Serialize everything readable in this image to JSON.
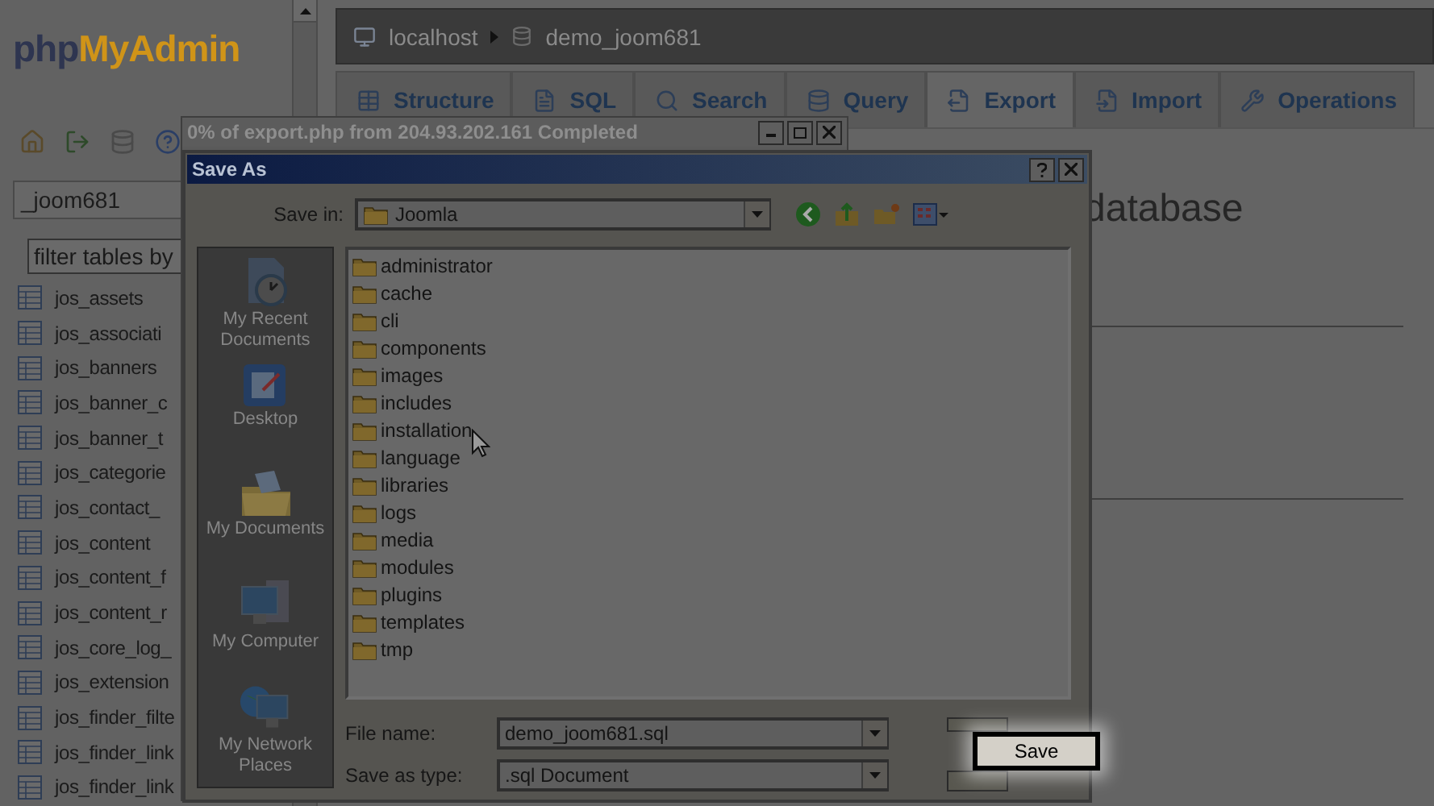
{
  "sidebar": {
    "logo": [
      "php",
      "MyAdmin"
    ],
    "database_select": "_joom681",
    "filter": {
      "placeholder": "filter tables by"
    },
    "tables": [
      "jos_assets",
      "jos_associati",
      "jos_banners",
      "jos_banner_c",
      "jos_banner_t",
      "jos_categorie",
      "jos_contact_",
      "jos_content",
      "jos_content_f",
      "jos_content_r",
      "jos_core_log_",
      "jos_extension",
      "jos_finder_filte",
      "jos_finder_link",
      "jos_finder_link"
    ]
  },
  "breadcrumb": [
    "localhost",
    "demo_joom681"
  ],
  "tabs": [
    {
      "label": "Structure",
      "selected": false
    },
    {
      "label": "SQL",
      "selected": false
    },
    {
      "label": "Search",
      "selected": false
    },
    {
      "label": "Query",
      "selected": false
    },
    {
      "label": "Export",
      "selected": true
    },
    {
      "label": "Import",
      "selected": false
    },
    {
      "label": "Operations",
      "selected": false
    }
  ],
  "heading": "database",
  "download_window": {
    "title": "0% of export.php from 204.93.202.161 Completed"
  },
  "save_dialog": {
    "title": "Save As",
    "save_in_label": "Save in:",
    "save_in": "Joomla",
    "places": [
      "My Recent Documents",
      "Desktop",
      "My Documents",
      "My Computer",
      "My Network Places"
    ],
    "files": [
      "administrator",
      "cache",
      "cli",
      "components",
      "images",
      "includes",
      "installation",
      "language",
      "libraries",
      "logs",
      "media",
      "modules",
      "plugins",
      "templates",
      "tmp"
    ],
    "file_name_label": "File name:",
    "file_name": "demo_joom681.sql",
    "type_label": "Save as type:",
    "type": ".sql Document",
    "highlighted_button": "Save"
  }
}
